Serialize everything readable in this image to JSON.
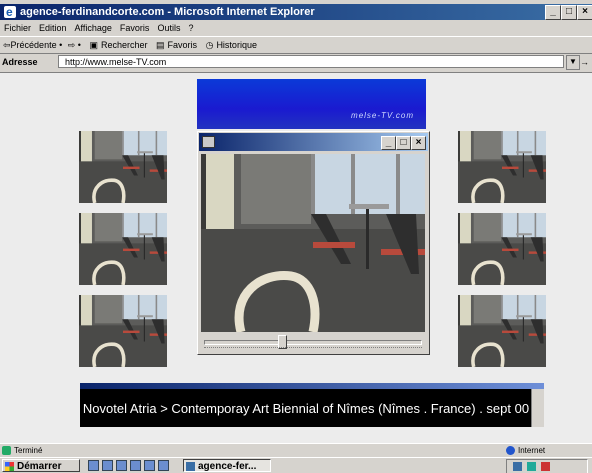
{
  "window": {
    "title": "agence-ferdinandcorte.com - Microsoft Internet Explorer",
    "minimize": "_",
    "maximize": "□",
    "close": "×"
  },
  "menu": [
    "Fichier",
    "Edition",
    "Affichage",
    "Favoris",
    "Outils",
    "?"
  ],
  "toolbar": {
    "back": "⇦Précédente •",
    "forward": "⇨ •",
    "search": "Rechercher",
    "favorites": "Favoris",
    "history": "Historique"
  },
  "address": {
    "label": "Adresse",
    "url": "http://www.melse-TV.com",
    "go": "→"
  },
  "page": {
    "banner_text": "melse-TV.com",
    "caption": "Novotel Atria > Contemporay Art Biennial of Nîmes (Nîmes . France) . sept 00"
  },
  "player": {
    "minimize": "_",
    "maximize": "□",
    "close": "×",
    "position": 0.36
  },
  "status": {
    "text": "Terminé",
    "zone": "Internet"
  },
  "taskbar": {
    "start": "Démarrer",
    "task": "agence-fer..."
  },
  "icons": [
    "ie-icon",
    "back-icon",
    "search-icon",
    "favorites-icon",
    "history-icon",
    "start-flag-icon",
    "internet-zone-icon"
  ]
}
